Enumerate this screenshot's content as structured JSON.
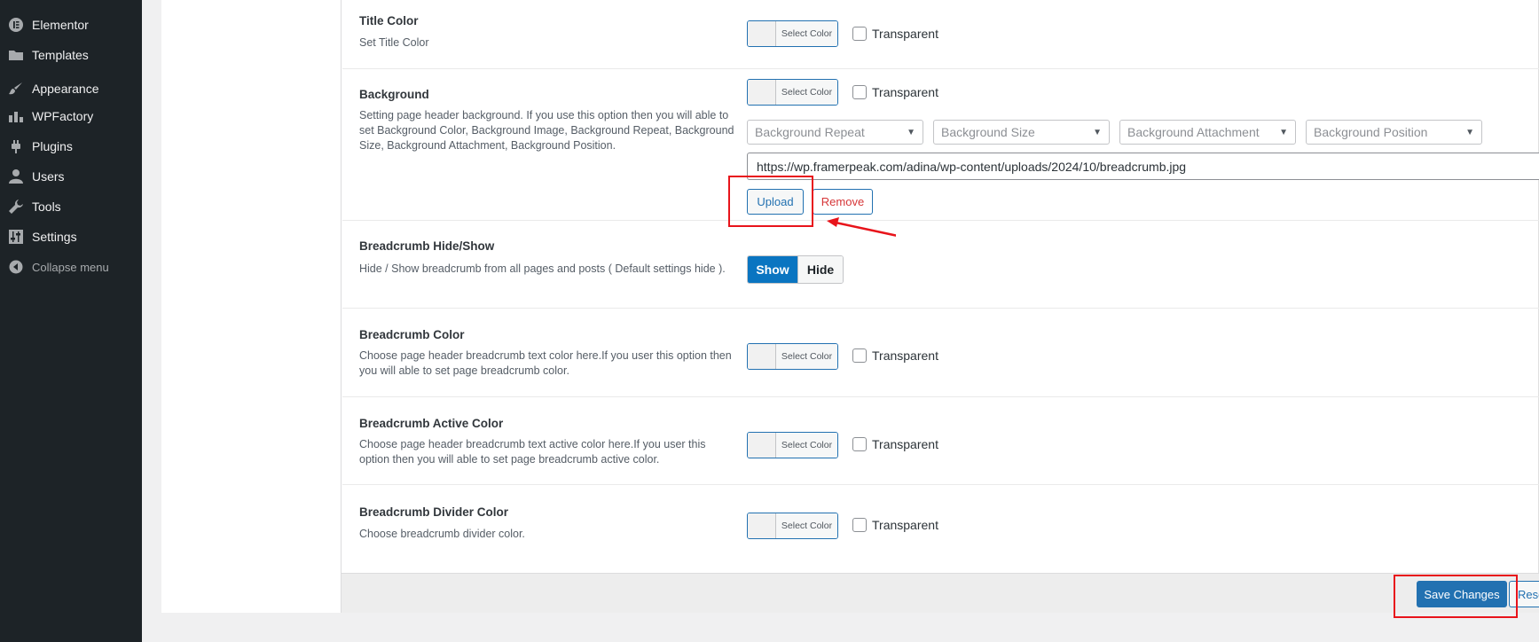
{
  "sidebar": {
    "items": [
      {
        "label": "Elementor",
        "icon": "elementor-icon"
      },
      {
        "label": "Templates",
        "icon": "folder-icon"
      },
      {
        "label": "Appearance",
        "icon": "paintbrush-icon"
      },
      {
        "label": "WPFactory",
        "icon": "chart-bar-icon"
      },
      {
        "label": "Plugins",
        "icon": "plugin-icon"
      },
      {
        "label": "Users",
        "icon": "user-icon"
      },
      {
        "label": "Tools",
        "icon": "wrench-icon"
      },
      {
        "label": "Settings",
        "icon": "sliders-icon"
      }
    ],
    "collapse_label": "Collapse menu"
  },
  "fields": {
    "title_color": {
      "title": "Title Color",
      "desc": "Set Title Color"
    },
    "background": {
      "title": "Background",
      "desc": "Setting page header background. If you use this option then you will able to set Background Color, Background Image, Background Repeat, Background Size, Background Attachment, Background Position."
    },
    "breadcrumb_hide_show": {
      "title": "Breadcrumb Hide/Show",
      "desc": "Hide / Show breadcrumb from all pages and posts ( Default settings hide )."
    },
    "breadcrumb_color": {
      "title": "Breadcrumb Color",
      "desc": "Choose page header breadcrumb text color here.If you user this option then you will able to set page breadcrumb color."
    },
    "breadcrumb_active_color": {
      "title": "Breadcrumb Active Color",
      "desc": "Choose page header breadcrumb text active color here.If you user this option then you will able to set page breadcrumb active color."
    },
    "breadcrumb_divider_color": {
      "title": "Breadcrumb Divider Color",
      "desc": "Choose breadcrumb divider color."
    }
  },
  "controls": {
    "select_color_label": "Select Color",
    "transparent_label": "Transparent",
    "selects": [
      {
        "placeholder": "Background Repeat"
      },
      {
        "placeholder": "Background Size"
      },
      {
        "placeholder": "Background Attachment"
      },
      {
        "placeholder": "Background Position"
      }
    ],
    "bg_image_url": "https://wp.framerpeak.com/adina/wp-content/uploads/2024/10/breadcrumb.jpg",
    "upload_label": "Upload",
    "remove_label": "Remove",
    "toggle_show": "Show",
    "toggle_hide": "Hide",
    "toggle_selected": "Show"
  },
  "footer": {
    "save_label": "Save Changes",
    "reset_label": "Rese"
  },
  "colors": {
    "sidebar_bg": "#1d2327",
    "primary": "#2271b1",
    "toggle_active": "#0a75c1",
    "annotation_red": "#e8141b",
    "remove_text": "#d63638"
  }
}
